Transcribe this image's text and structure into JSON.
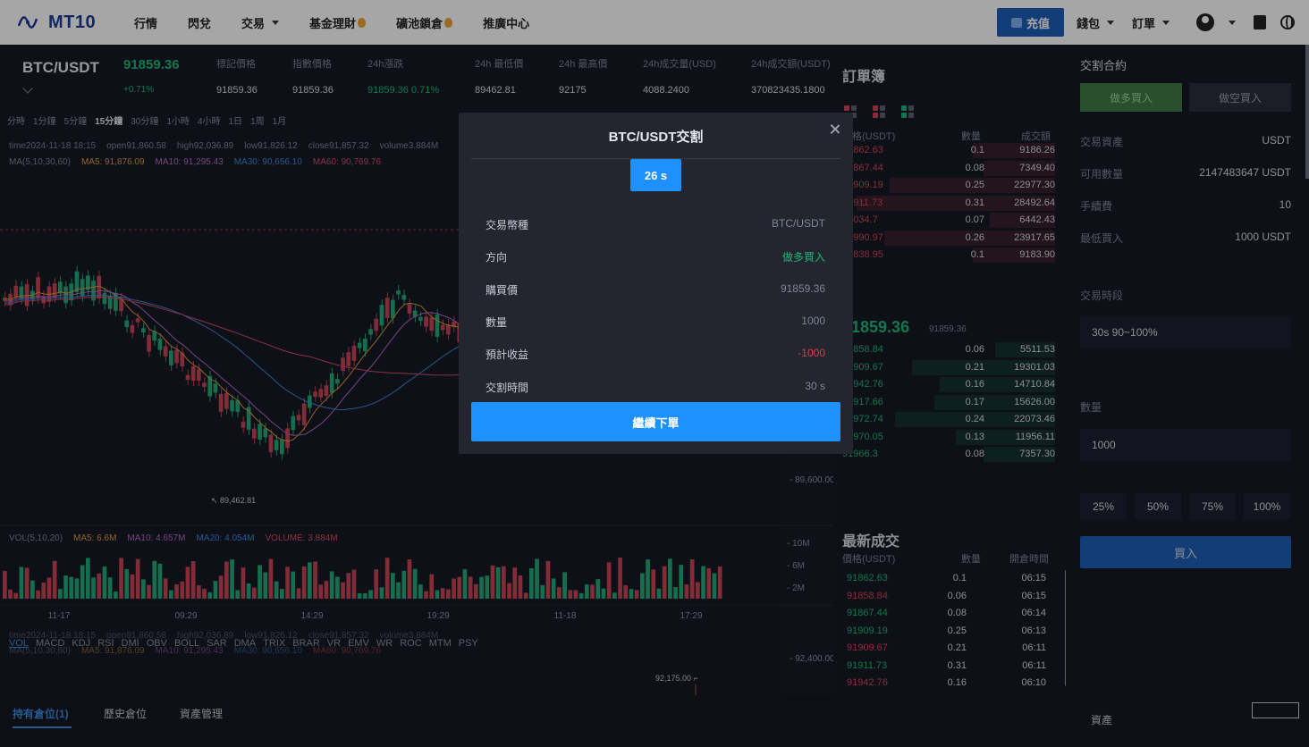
{
  "nav": {
    "logo": "MT10",
    "items": [
      {
        "label": "行情",
        "caret": false,
        "hot": false
      },
      {
        "label": "閃兌",
        "caret": false,
        "hot": false
      },
      {
        "label": "交易",
        "caret": true,
        "hot": false
      },
      {
        "label": "基金理財",
        "caret": false,
        "hot": true
      },
      {
        "label": "礦池鎖倉",
        "caret": false,
        "hot": true
      },
      {
        "label": "推廣中心",
        "caret": false,
        "hot": false
      }
    ],
    "deposit": "充值",
    "wallet": "錢包",
    "orders": "訂單"
  },
  "ticker": {
    "pair": "BTC/USDT",
    "price": "91859.36",
    "change": "+0.71%",
    "stats": [
      {
        "label": "標記價格",
        "value": "91859.36"
      },
      {
        "label": "指數價格",
        "value": "91859.36"
      },
      {
        "label": "24h漲跌",
        "value": "91859.36  0.71%"
      },
      {
        "label": "24h 最低價",
        "value": "89462.81"
      },
      {
        "label": "24h 最高價",
        "value": "92175"
      },
      {
        "label": "24h成交量(USD)",
        "value": "4088.2400"
      },
      {
        "label": "24h成交額(USDT)",
        "value": "370823435.1800"
      }
    ]
  },
  "chart": {
    "intervals": [
      "分時",
      "1分鐘",
      "5分鐘",
      "15分鐘",
      "30分鐘",
      "1小時",
      "4小時",
      "1日",
      "1周",
      "1月"
    ],
    "active_interval": "15分鐘",
    "info": {
      "time": "time2024-11-18 18:15",
      "open": "open91,860.58",
      "high": "high92,036.89",
      "low": "low91,826.12",
      "close": "close91,857.32",
      "volume": "volume3.884M"
    },
    "ma": {
      "label": "MA(5,10,30,60)",
      "ma5": "MA5: 91,876.09",
      "ma10": "MA10: 91,295.43",
      "ma30": "MA30: 90,656.10",
      "ma60": "MA60: 90,769.76"
    },
    "vol": {
      "label": "VOL(5,10,20)",
      "ma5": "MA5: 6.6M",
      "ma10": "MA10: 4.657M",
      "ma20": "MA20: 4.054M",
      "volume": "VOLUME: 3.884M"
    },
    "price_axis": [
      "89,600.00",
      "92,400.00"
    ],
    "vol_axis": [
      "10M",
      "6M",
      "2M"
    ],
    "time_axis": [
      "11-17",
      "09:29",
      "14:29",
      "19:29",
      "11-18",
      "17:29"
    ],
    "low_marker": "89,462.81",
    "high_marker": "92,175.00",
    "indicators": [
      "VOL",
      "MACD",
      "KDJ",
      "RSI",
      "DMI",
      "OBV",
      "BOLL",
      "SAR",
      "DMA",
      "TRIX",
      "BRAR",
      "VR",
      "EMV",
      "WR",
      "ROC",
      "MTM",
      "PSY"
    ]
  },
  "orderbook": {
    "title": "訂單簿",
    "headers": {
      "price": "價格(USDT)",
      "qty": "數量",
      "total": "成交額"
    },
    "asks": [
      {
        "price": "91862.63",
        "qty": "0.1",
        "total": "9186.26"
      },
      {
        "price": "91867.44",
        "qty": "0.08",
        "total": "7349.40"
      },
      {
        "price": "91909.19",
        "qty": "0.25",
        "total": "22977.30"
      },
      {
        "price": "91911.73",
        "qty": "0.31",
        "total": "28492.64"
      },
      {
        "price": "92034.7",
        "qty": "0.07",
        "total": "6442.43"
      },
      {
        "price": "91990.97",
        "qty": "0.26",
        "total": "23917.65"
      },
      {
        "price": "91838.95",
        "qty": "0.1",
        "total": "9183.90"
      }
    ],
    "mid": "91859.36",
    "mid_sub": "91859.36",
    "bids": [
      {
        "price": "91858.84",
        "qty": "0.06",
        "total": "5511.53"
      },
      {
        "price": "91909.67",
        "qty": "0.21",
        "total": "19301.03"
      },
      {
        "price": "91942.76",
        "qty": "0.16",
        "total": "14710.84"
      },
      {
        "price": "91917.66",
        "qty": "0.17",
        "total": "15626.00"
      },
      {
        "price": "91972.74",
        "qty": "0.24",
        "total": "22073.46"
      },
      {
        "price": "91970.05",
        "qty": "0.13",
        "total": "11956.11"
      },
      {
        "price": "91966.3",
        "qty": "0.08",
        "total": "7357.30"
      }
    ]
  },
  "trades": {
    "title": "最新成交",
    "headers": {
      "price": "價格(USDT)",
      "qty": "數量",
      "time": "開倉時間"
    },
    "rows": [
      {
        "price": "91862.63",
        "qty": "0.1",
        "time": "06:15",
        "side": "buy"
      },
      {
        "price": "91858.84",
        "qty": "0.06",
        "time": "06:15",
        "side": "sell"
      },
      {
        "price": "91867.44",
        "qty": "0.08",
        "time": "06:14",
        "side": "buy"
      },
      {
        "price": "91909.19",
        "qty": "0.25",
        "time": "06:13",
        "side": "buy"
      },
      {
        "price": "91909.67",
        "qty": "0.21",
        "time": "06:11",
        "side": "sell"
      },
      {
        "price": "91911.73",
        "qty": "0.31",
        "time": "06:11",
        "side": "buy"
      },
      {
        "price": "91942.76",
        "qty": "0.16",
        "time": "06:10",
        "side": "sell"
      }
    ]
  },
  "trade_panel": {
    "title": "交割合約",
    "long_tab": "做多買入",
    "short_tab": "做空買入",
    "asset_label": "交易資產",
    "asset_value": "USDT",
    "available_label": "可用數量",
    "available_value": "2147483647 USDT",
    "fee_label": "手續費",
    "fee_value": "10",
    "min_label": "最低買入",
    "min_value": "1000 USDT",
    "period_label": "交易時段",
    "period_value": "30s 90~100%",
    "qty_label": "數量",
    "qty_value": "1000",
    "percents": [
      "25%",
      "50%",
      "75%",
      "100%"
    ],
    "buy": "買入"
  },
  "bottom": {
    "tabs": [
      "持有倉位(1)",
      "歷史倉位",
      "資產管理"
    ],
    "asset_title": "資產"
  },
  "modal": {
    "title": "BTC/USDT交割",
    "countdown": "26 s",
    "rows": [
      {
        "label": "交易幣種",
        "value": "BTC/USDT",
        "color": "#7d8595"
      },
      {
        "label": "方向",
        "value": "做多買入",
        "color": "#1fb57a"
      },
      {
        "label": "購買價",
        "value": "91859.36",
        "color": "#7d8595"
      },
      {
        "label": "數量",
        "value": "1000",
        "color": "#7d8595"
      },
      {
        "label": "預計收益",
        "value": "-1000",
        "color": "#e0394f"
      },
      {
        "label": "交割時間",
        "value": "30 s",
        "color": "#7d8595"
      }
    ],
    "continue": "繼續下單"
  },
  "colors": {
    "up": "#1fb57a",
    "down": "#d3445a",
    "accent": "#1e90ff",
    "brand": "#1f3a93"
  }
}
